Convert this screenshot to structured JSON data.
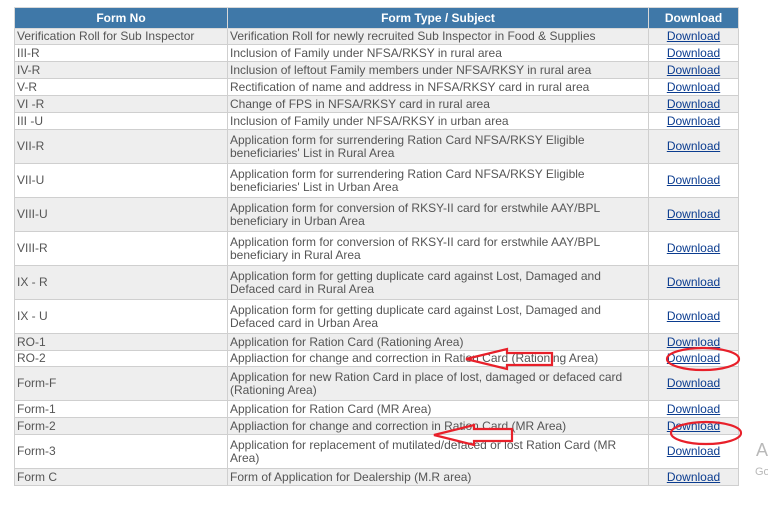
{
  "table": {
    "headers": {
      "form_no": "Form No",
      "subject": "Form Type / Subject",
      "download": "Download"
    },
    "rows": [
      {
        "form_no": "Verification Roll for Sub Inspector",
        "subject": "Verification Roll for newly recruited Sub Inspector in Food & Supplies",
        "link": "Download"
      },
      {
        "form_no": "III-R",
        "subject": "Inclusion of Family under NFSA/RKSY in rural area",
        "link": "Download"
      },
      {
        "form_no": "IV-R",
        "subject": "Inclusion of leftout Family members under NFSA/RKSY in rural area",
        "link": "Download"
      },
      {
        "form_no": "V-R",
        "subject": "Rectification of name and address in NFSA/RKSY card in rural area",
        "link": "Download"
      },
      {
        "form_no": "VI -R",
        "subject": "Change of FPS in NFSA/RKSY card in rural area",
        "link": "Download"
      },
      {
        "form_no": "III -U",
        "subject": "Inclusion of Family under NFSA/RKSY in urban area",
        "link": "Download"
      },
      {
        "form_no": "VII-R",
        "subject": "Application form for surrendering Ration Card NFSA/RKSY Eligible beneficiaries' List in Rural Area",
        "link": "Download"
      },
      {
        "form_no": "VII-U",
        "subject": "Application form for surrendering Ration Card NFSA/RKSY Eligible beneficiaries' List in Urban Area",
        "link": "Download"
      },
      {
        "form_no": "VIII-U",
        "subject": "Application form for conversion of RKSY-II card for erstwhile AAY/BPL beneficiary in Urban Area",
        "link": "Download"
      },
      {
        "form_no": "VIII-R",
        "subject": "Application form for conversion of RKSY-II card for erstwhile AAY/BPL beneficiary in Rural Area",
        "link": "Download"
      },
      {
        "form_no": "IX - R",
        "subject": "Application form for getting duplicate card against Lost, Damaged and Defaced card in Rural Area",
        "link": "Download"
      },
      {
        "form_no": "IX - U",
        "subject": "Application form for getting duplicate card against Lost, Damaged and Defaced card in Urban Area",
        "link": "Download"
      },
      {
        "form_no": "RO-1",
        "subject": "Application for Ration Card (Rationing Area)",
        "link": "Download"
      },
      {
        "form_no": "RO-2",
        "subject": "Appliaction for change and correction in Ration Card (Rationing Area)",
        "link": "Download"
      },
      {
        "form_no": "Form-F",
        "subject": "Application for new Ration Card in place of lost, damaged or defaced card (Rationing Area)",
        "link": "Download"
      },
      {
        "form_no": "Form-1",
        "subject": "Application for Ration Card (MR Area)",
        "link": "Download"
      },
      {
        "form_no": "Form-2",
        "subject": "Appliaction for change and correction in Ration Card (MR Area)",
        "link": "Download"
      },
      {
        "form_no": "Form-3",
        "subject": "Application for replacement of mutilated/defaced or lost Ration Card (MR Area)",
        "link": "Download"
      },
      {
        "form_no": "Form C",
        "subject": "Form of Application for Dealership (M.R area)",
        "link": "Download"
      }
    ]
  },
  "watermark": {
    "line1": "Ac",
    "line2": "Go"
  },
  "annotation_color": "#e8202a"
}
